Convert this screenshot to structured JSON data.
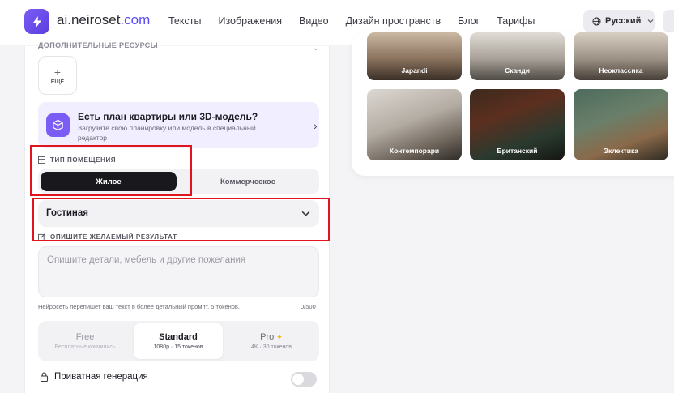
{
  "header": {
    "logo_main": "ai.neiroset",
    "logo_suffix": ".com",
    "nav": [
      "Тексты",
      "Изображения",
      "Видео",
      "Дизайн пространств",
      "Блог",
      "Тарифы"
    ],
    "language": "Русский"
  },
  "left": {
    "cut_label": "ДОПОЛНИТЕЛЬНЫЕ РЕСУРСЫ",
    "more_plus": "+",
    "more_label": "ЕЩЁ",
    "plan_title": "Есть план квартиры или 3D-модель?",
    "plan_subtitle": "Загрузите свою планировку или модель в специальный редактор",
    "room_type_label": "ТИП ПОМЕЩЕНИЯ",
    "room_types": [
      "Жилое",
      "Коммерческое"
    ],
    "room_type_selected": "Жилое",
    "room_select_value": "Гостиная",
    "describe_label": "ОПИШИТЕ ЖЕЛАЕМЫЙ РЕЗУЛЬТАТ",
    "prompt_placeholder": "Опишите детали, мебель и другие пожелания",
    "hint": "Нейросеть перепишет ваш текст в более детальный промпт. 5 токенов.",
    "counter": "0/500",
    "quality": [
      {
        "name": "Free",
        "desc": "Бесплатные кончились"
      },
      {
        "name": "Standard",
        "desc": "1080p · 15 токенов"
      },
      {
        "name": "Pro",
        "desc": "4K · 30 токенов"
      }
    ],
    "quality_selected": "Standard",
    "private_label": "Приватная генерация",
    "private_enabled": false
  },
  "styles": {
    "row1": [
      "Japandi",
      "Сканди",
      "Неоклассика"
    ],
    "row2": [
      "Контемпорари",
      "Британский",
      "Эклектика"
    ]
  },
  "colors": {
    "accent": "#7b5cf5",
    "highlight": "#e0141e",
    "segment_active": "#18181d"
  }
}
